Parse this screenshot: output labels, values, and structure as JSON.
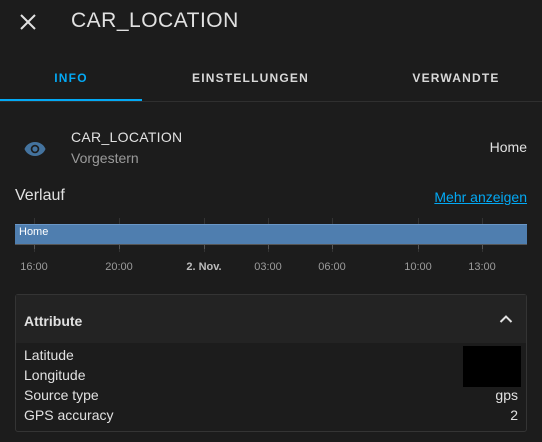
{
  "header": {
    "close_icon": "close-icon",
    "title": "CAR_LOCATION"
  },
  "tabs": [
    {
      "label": "INFO",
      "active": true
    },
    {
      "label": "EINSTELLUNGEN",
      "active": false
    },
    {
      "label": "VERWANDTE",
      "active": false
    }
  ],
  "entity": {
    "icon": "eye-icon",
    "name": "CAR_LOCATION",
    "last_changed": "Vorgestern",
    "state": "Home"
  },
  "history": {
    "title": "Verlauf",
    "more_link": "Mehr anzeigen",
    "bar_label": "Home",
    "ticks": [
      "16:00",
      "20:00",
      "2. Nov.",
      "03:00",
      "06:00",
      "10:00",
      "13:00"
    ]
  },
  "attributes": {
    "title": "Attribute",
    "rows": [
      {
        "key": "Latitude",
        "value": ""
      },
      {
        "key": "Longitude",
        "value": ""
      },
      {
        "key": "Source type",
        "value": "gps"
      },
      {
        "key": "GPS accuracy",
        "value": "2"
      }
    ]
  },
  "colors": {
    "accent": "#03a9f4",
    "icon": "#44739e",
    "timeline_bar": "#4f7eaf",
    "background": "#1c1c1c"
  }
}
